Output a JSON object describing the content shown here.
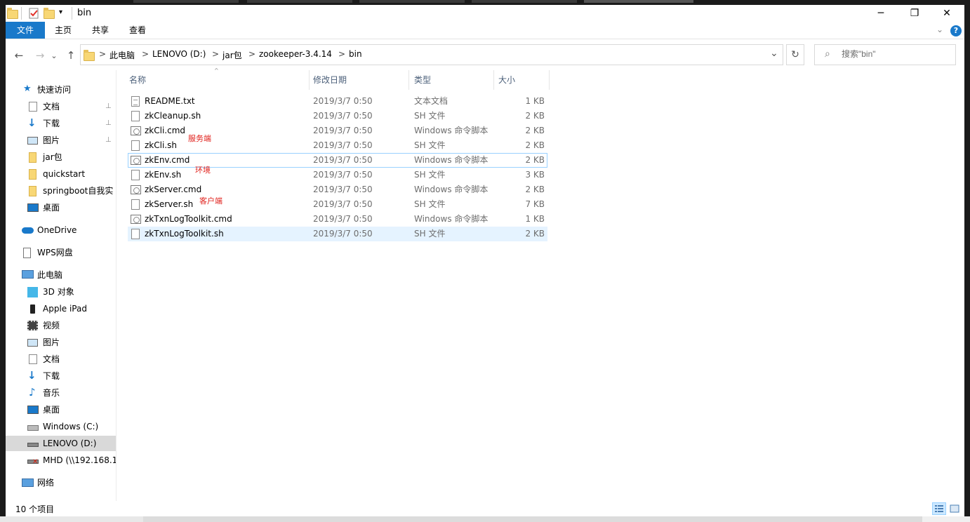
{
  "window": {
    "title": "bin",
    "controls": {
      "minimize": "─",
      "maximize": "❐",
      "close": "✕"
    }
  },
  "ribbon": {
    "tabs": [
      "文件",
      "主页",
      "共享",
      "查看"
    ],
    "expand_icon": "chevron-down-icon",
    "help_icon": "help-icon",
    "help_glyph": "?",
    "accent": "#1979ca"
  },
  "address": {
    "segments": [
      "此电脑",
      "LENOVO (D:)",
      "jar包",
      "zookeeper-3.4.14",
      "bin"
    ],
    "separator": ">",
    "dropdown_glyph": "⌄",
    "refresh_glyph": "↻"
  },
  "nav_buttons": {
    "back": "←",
    "forward": "→",
    "recent": "⌄",
    "up": "↑"
  },
  "search": {
    "placeholder": "搜索\"bin\"",
    "glyph": "⌕"
  },
  "sidebar": {
    "items": [
      {
        "label": "快速访问",
        "icon": "star-icon",
        "level": 0,
        "pinned": false
      },
      {
        "label": "文档",
        "icon": "document-icon",
        "level": 1,
        "pinned": true
      },
      {
        "label": "下载",
        "icon": "download-icon",
        "level": 1,
        "pinned": true
      },
      {
        "label": "图片",
        "icon": "pictures-icon",
        "level": 1,
        "pinned": true
      },
      {
        "label": "jar包",
        "icon": "folder-icon",
        "level": 1,
        "pinned": false
      },
      {
        "label": "quickstart",
        "icon": "folder-icon",
        "level": 1,
        "pinned": false
      },
      {
        "label": "springboot自我实",
        "icon": "folder-icon",
        "level": 1,
        "pinned": false
      },
      {
        "label": "桌面",
        "icon": "desktop-icon",
        "level": 1,
        "pinned": false
      },
      {
        "label": "OneDrive",
        "icon": "cloud-icon",
        "level": 0,
        "pinned": false
      },
      {
        "label": "WPS网盘",
        "icon": "wps-drive-icon",
        "level": 0,
        "pinned": false
      },
      {
        "label": "此电脑",
        "icon": "computer-icon",
        "level": 0,
        "pinned": false
      },
      {
        "label": "3D 对象",
        "icon": "3d-objects-icon",
        "level": 1,
        "pinned": false
      },
      {
        "label": "Apple iPad",
        "icon": "ipad-icon",
        "level": 1,
        "pinned": false
      },
      {
        "label": "视频",
        "icon": "video-icon",
        "level": 1,
        "pinned": false
      },
      {
        "label": "图片",
        "icon": "pictures-icon",
        "level": 1,
        "pinned": false
      },
      {
        "label": "文档",
        "icon": "document-icon",
        "level": 1,
        "pinned": false
      },
      {
        "label": "下载",
        "icon": "download-icon",
        "level": 1,
        "pinned": false
      },
      {
        "label": "音乐",
        "icon": "music-icon",
        "level": 1,
        "pinned": false
      },
      {
        "label": "桌面",
        "icon": "desktop-icon",
        "level": 1,
        "pinned": false
      },
      {
        "label": "Windows (C:)",
        "icon": "windows-drive-icon",
        "level": 1,
        "pinned": false
      },
      {
        "label": "LENOVO (D:)",
        "icon": "drive-icon",
        "level": 1,
        "pinned": false,
        "selected": true
      },
      {
        "label": "MHD (\\\\192.168.1",
        "icon": "network-drive-disconnected-icon",
        "level": 1,
        "pinned": false
      },
      {
        "label": "网络",
        "icon": "network-icon",
        "level": 0,
        "pinned": false
      }
    ],
    "pin_glyph": "📌"
  },
  "file_list": {
    "columns": [
      "名称",
      "修改日期",
      "类型",
      "大小"
    ],
    "rows": [
      {
        "name": "README.txt",
        "date": "2019/3/7 0:50",
        "type": "文本文档",
        "size": "1 KB",
        "icon": "text-file-icon"
      },
      {
        "name": "zkCleanup.sh",
        "date": "2019/3/7 0:50",
        "type": "SH 文件",
        "size": "2 KB",
        "icon": "file-icon"
      },
      {
        "name": "zkCli.cmd",
        "date": "2019/3/7 0:50",
        "type": "Windows 命令脚本",
        "size": "2 KB",
        "icon": "cmd-file-icon"
      },
      {
        "name": "zkCli.sh",
        "date": "2019/3/7 0:50",
        "type": "SH 文件",
        "size": "2 KB",
        "icon": "file-icon"
      },
      {
        "name": "zkEnv.cmd",
        "date": "2019/3/7 0:50",
        "type": "Windows 命令脚本",
        "size": "2 KB",
        "icon": "cmd-file-icon",
        "focused": true
      },
      {
        "name": "zkEnv.sh",
        "date": "2019/3/7 0:50",
        "type": "SH 文件",
        "size": "3 KB",
        "icon": "file-icon"
      },
      {
        "name": "zkServer.cmd",
        "date": "2019/3/7 0:50",
        "type": "Windows 命令脚本",
        "size": "2 KB",
        "icon": "cmd-file-icon"
      },
      {
        "name": "zkServer.sh",
        "date": "2019/3/7 0:50",
        "type": "SH 文件",
        "size": "7 KB",
        "icon": "file-icon"
      },
      {
        "name": "zkTxnLogToolkit.cmd",
        "date": "2019/3/7 0:50",
        "type": "Windows 命令脚本",
        "size": "1 KB",
        "icon": "cmd-file-icon"
      },
      {
        "name": "zkTxnLogToolkit.sh",
        "date": "2019/3/7 0:50",
        "type": "SH 文件",
        "size": "2 KB",
        "icon": "file-icon",
        "selected": true
      }
    ],
    "sort_glyph": "^"
  },
  "annotations": [
    "服务端",
    "环境",
    "客户端"
  ],
  "status_bar": {
    "item_count": "10 个项目",
    "views": [
      "details-view-icon",
      "large-icons-view-icon"
    ]
  }
}
